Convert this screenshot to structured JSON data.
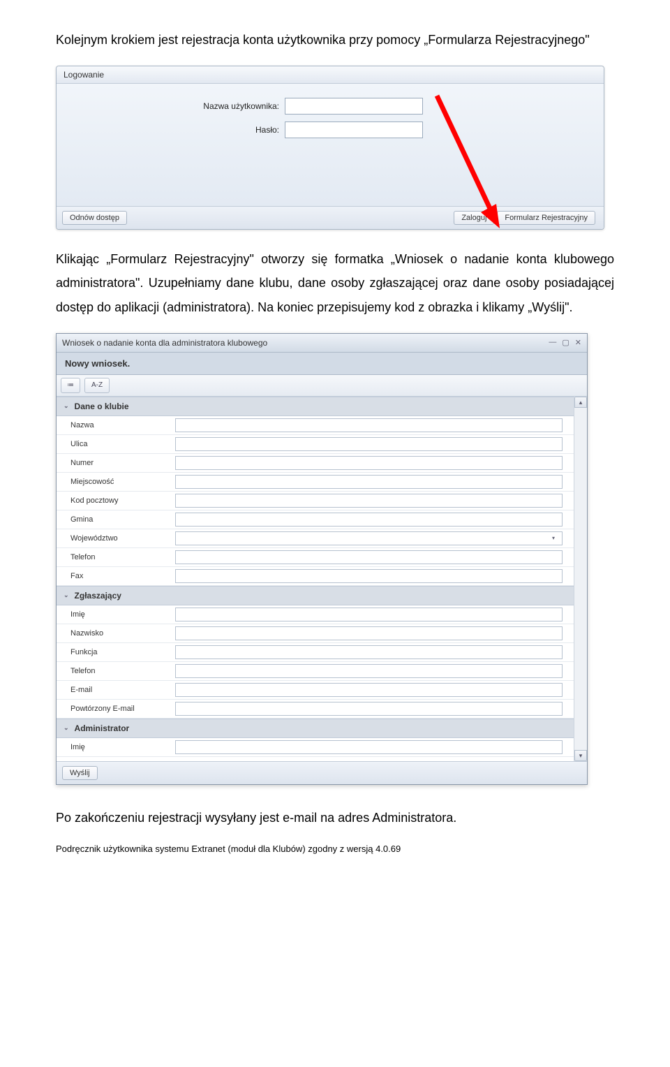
{
  "paragraph1_prefix": "Kolejnym krokiem jest rejestracja konta użytkownika przy pomocy „Formularza Rejestracyjnego\"",
  "login": {
    "title": "Logowanie",
    "username_label": "Nazwa użytkownika:",
    "password_label": "Hasło:",
    "recover_btn": "Odnów dostęp",
    "login_btn": "Zaloguj",
    "register_btn": "Formularz Rejestracyjny"
  },
  "paragraph2": "Klikając „Formularz Rejestracyjny\" otworzy się formatka „Wniosek o nadanie konta klubowego administratora\". Uzupełniamy dane klubu, dane osoby zgłaszającej oraz dane osoby posiadającej dostęp do aplikacji (administratora). Na koniec przepisujemy kod z obrazka i klikamy „Wyślij\".",
  "win": {
    "title": "Wniosek o nadanie konta dla administratora klubowego",
    "subtitle": "Nowy wniosek.",
    "tool_list": "≔",
    "tool_az": "A-Z",
    "send_btn": "Wyślij",
    "sections": {
      "club": {
        "header": "Dane o klubie",
        "fields": {
          "name": "Nazwa",
          "street": "Ulica",
          "number": "Numer",
          "city": "Miejscowość",
          "postcode": "Kod pocztowy",
          "gmina": "Gmina",
          "voivodeship": "Województwo",
          "phone": "Telefon",
          "fax": "Fax"
        }
      },
      "reporter": {
        "header": "Zgłaszający",
        "fields": {
          "fname": "Imię",
          "lname": "Nazwisko",
          "function": "Funkcja",
          "phone": "Telefon",
          "email": "E-mail",
          "email2": "Powtórzony E-mail"
        }
      },
      "admin": {
        "header": "Administrator",
        "fields": {
          "fname": "Imię"
        }
      }
    }
  },
  "paragraph3": "Po zakończeniu rejestracji wysyłany jest e-mail na adres Administratora.",
  "footer": "Podręcznik użytkownika systemu Extranet (moduł dla Klubów) zgodny z wersją 4.0.69"
}
